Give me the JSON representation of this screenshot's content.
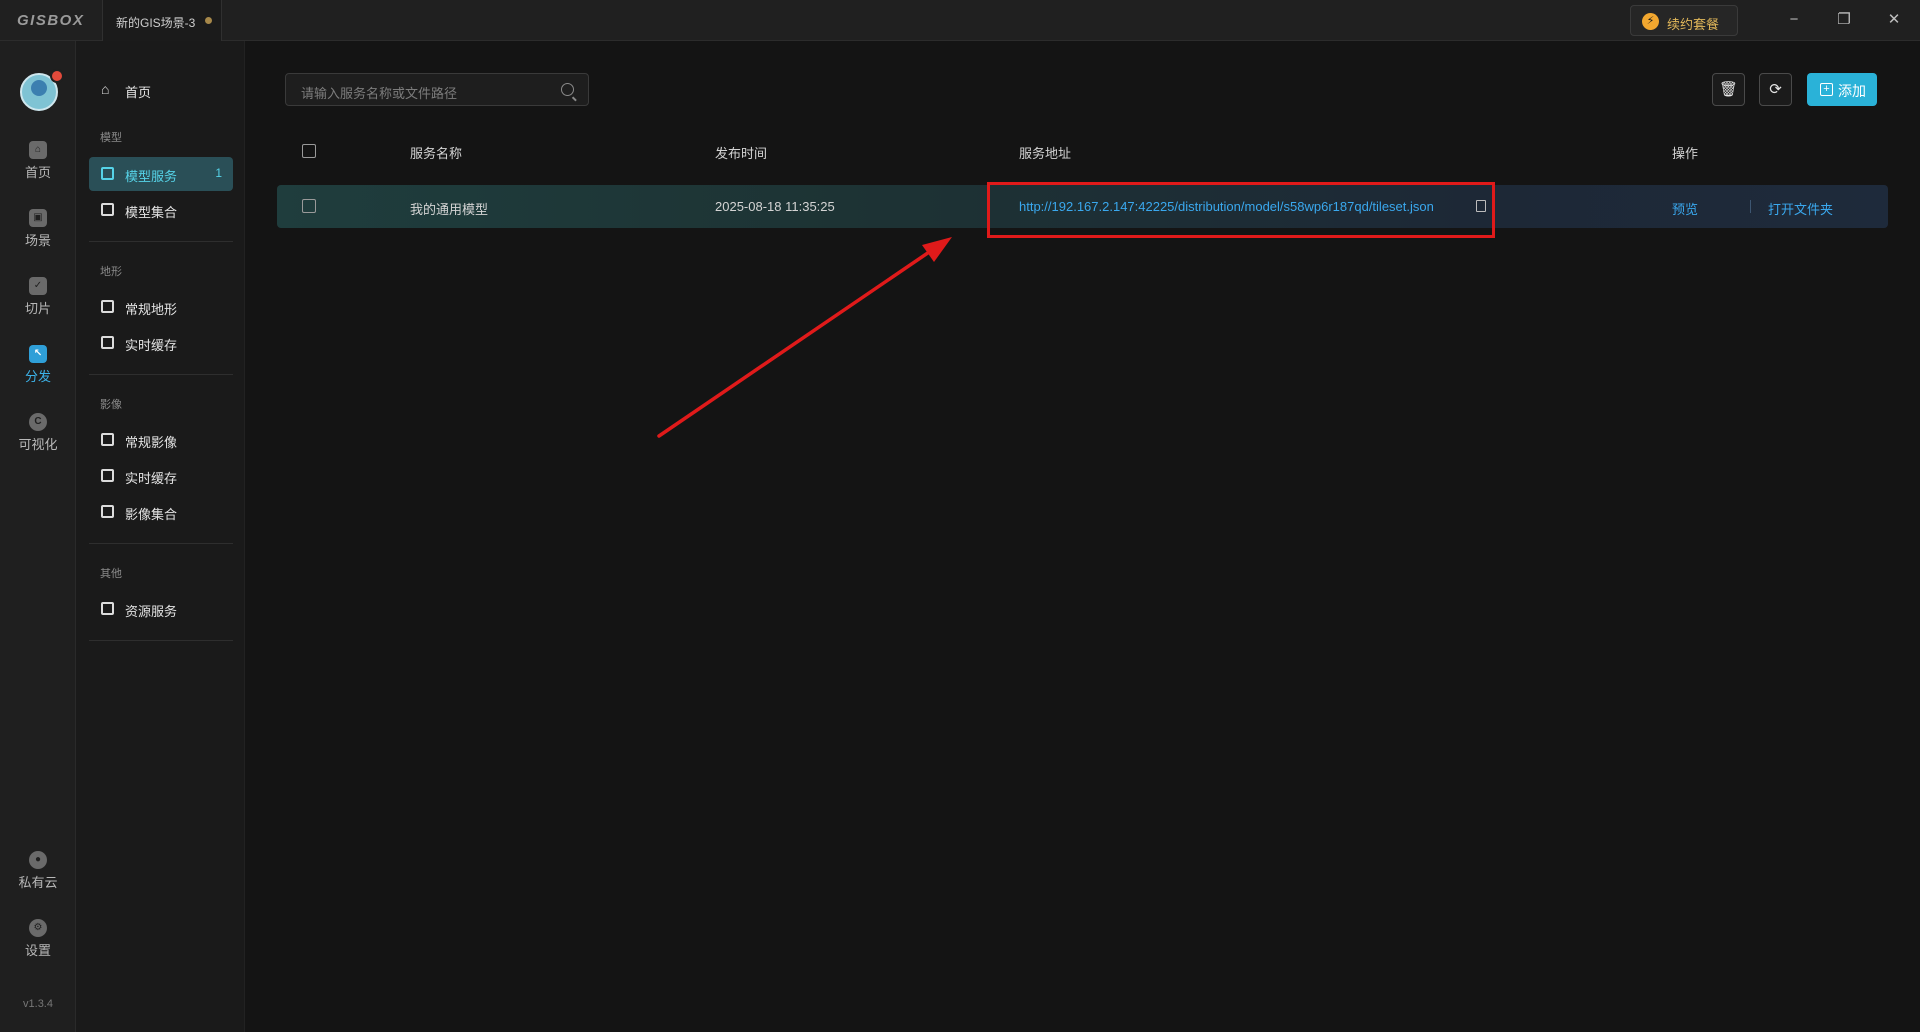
{
  "titlebar": {
    "logo": "GISBOX",
    "tab_label": "新的GIS场景-3",
    "renew_label": "续约套餐",
    "minimize": "−",
    "restore": "❐",
    "close": "✕"
  },
  "rail": {
    "items": [
      {
        "label": "首页",
        "icon": "home-icon"
      },
      {
        "label": "场景",
        "icon": "scene-icon"
      },
      {
        "label": "切片",
        "icon": "slice-icon"
      },
      {
        "label": "分发",
        "icon": "distribute-icon"
      },
      {
        "label": "可视化",
        "icon": "visualize-icon"
      },
      {
        "label": "私有云",
        "icon": "lock-icon"
      },
      {
        "label": "设置",
        "icon": "settings-icon"
      }
    ],
    "version": "v1.3.4"
  },
  "sidenav": {
    "home": "首页",
    "group_model": "模型",
    "model_service": "模型服务",
    "model_service_count": "1",
    "model_collection": "模型集合",
    "group_terrain": "地形",
    "terrain_regular": "常规地形",
    "terrain_cache": "实时缓存",
    "group_imagery": "影像",
    "imagery_regular": "常规影像",
    "imagery_cache": "实时缓存",
    "imagery_collection": "影像集合",
    "group_other": "其他",
    "resource_service": "资源服务"
  },
  "toolbar": {
    "search_placeholder": "请输入服务名称或文件路径",
    "add_label": "添加"
  },
  "table": {
    "headers": {
      "name": "服务名称",
      "time": "发布时间",
      "url": "服务地址",
      "ops": "操作"
    },
    "rows": [
      {
        "name": "我的通用模型",
        "time": "2025-08-18 11:35:25",
        "url": "http://192.167.2.147:42225/distribution/model/s58wp6r187qd/tileset.json",
        "op_preview": "预览",
        "op_open": "打开文件夹"
      }
    ]
  },
  "colors": {
    "accent": "#2ab2d8",
    "annotation": "#e01a1a",
    "link": "#3aa8ee"
  }
}
